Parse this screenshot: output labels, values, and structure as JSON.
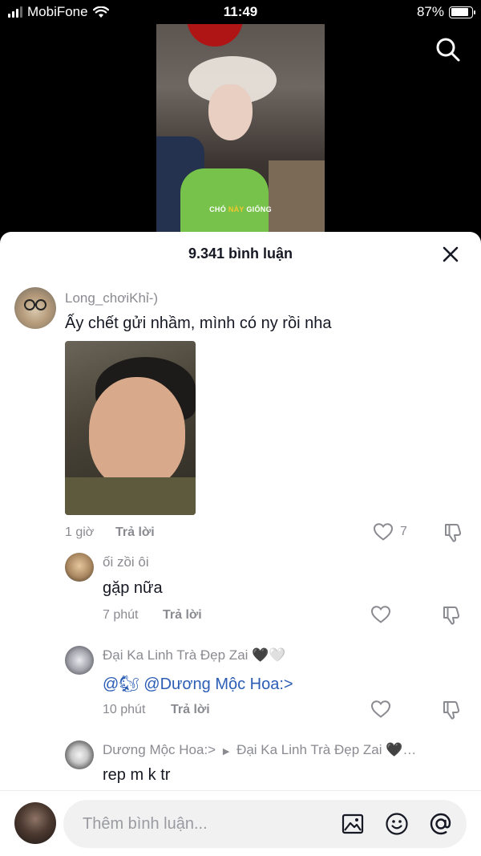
{
  "status_bar": {
    "carrier": "MobiFone",
    "time": "11:49",
    "battery_percent": "87%",
    "battery_level": 0.87
  },
  "video": {
    "caption_part1": "CHÓ ",
    "caption_highlight": "NÀY",
    "caption_part2": " GIỐNG"
  },
  "sheet": {
    "title": "9.341 bình luận"
  },
  "comments": [
    {
      "author": "Long_chơiKhỉ-)",
      "text": "Ấy chết gửi nhầm, mình có ny rồi nha",
      "time": "1 giờ",
      "reply_label": "Trả lời",
      "likes": "7",
      "has_photo": true
    },
    {
      "author": "ối zồi ôi",
      "text": "gặp nữa",
      "time": "7 phút",
      "reply_label": "Trả lời"
    },
    {
      "author": "Đại Ka Linh Trà Đẹp Zai 🖤🤍",
      "text_prefix": "@🐿",
      "text_mention": "@Dương Mộc Hoa:>",
      "time": "10 phút",
      "reply_label": "Trả lời"
    },
    {
      "author": "Dương Mộc Hoa:>",
      "reply_to": "Đại Ka Linh Trà Đẹp Zai 🖤…",
      "text": "rep m k tr"
    }
  ],
  "input": {
    "placeholder": "Thêm bình luận..."
  },
  "colors": {
    "mention": "#2b5db5",
    "secondary_text": "#8a8b91",
    "primary_text": "#161823"
  }
}
